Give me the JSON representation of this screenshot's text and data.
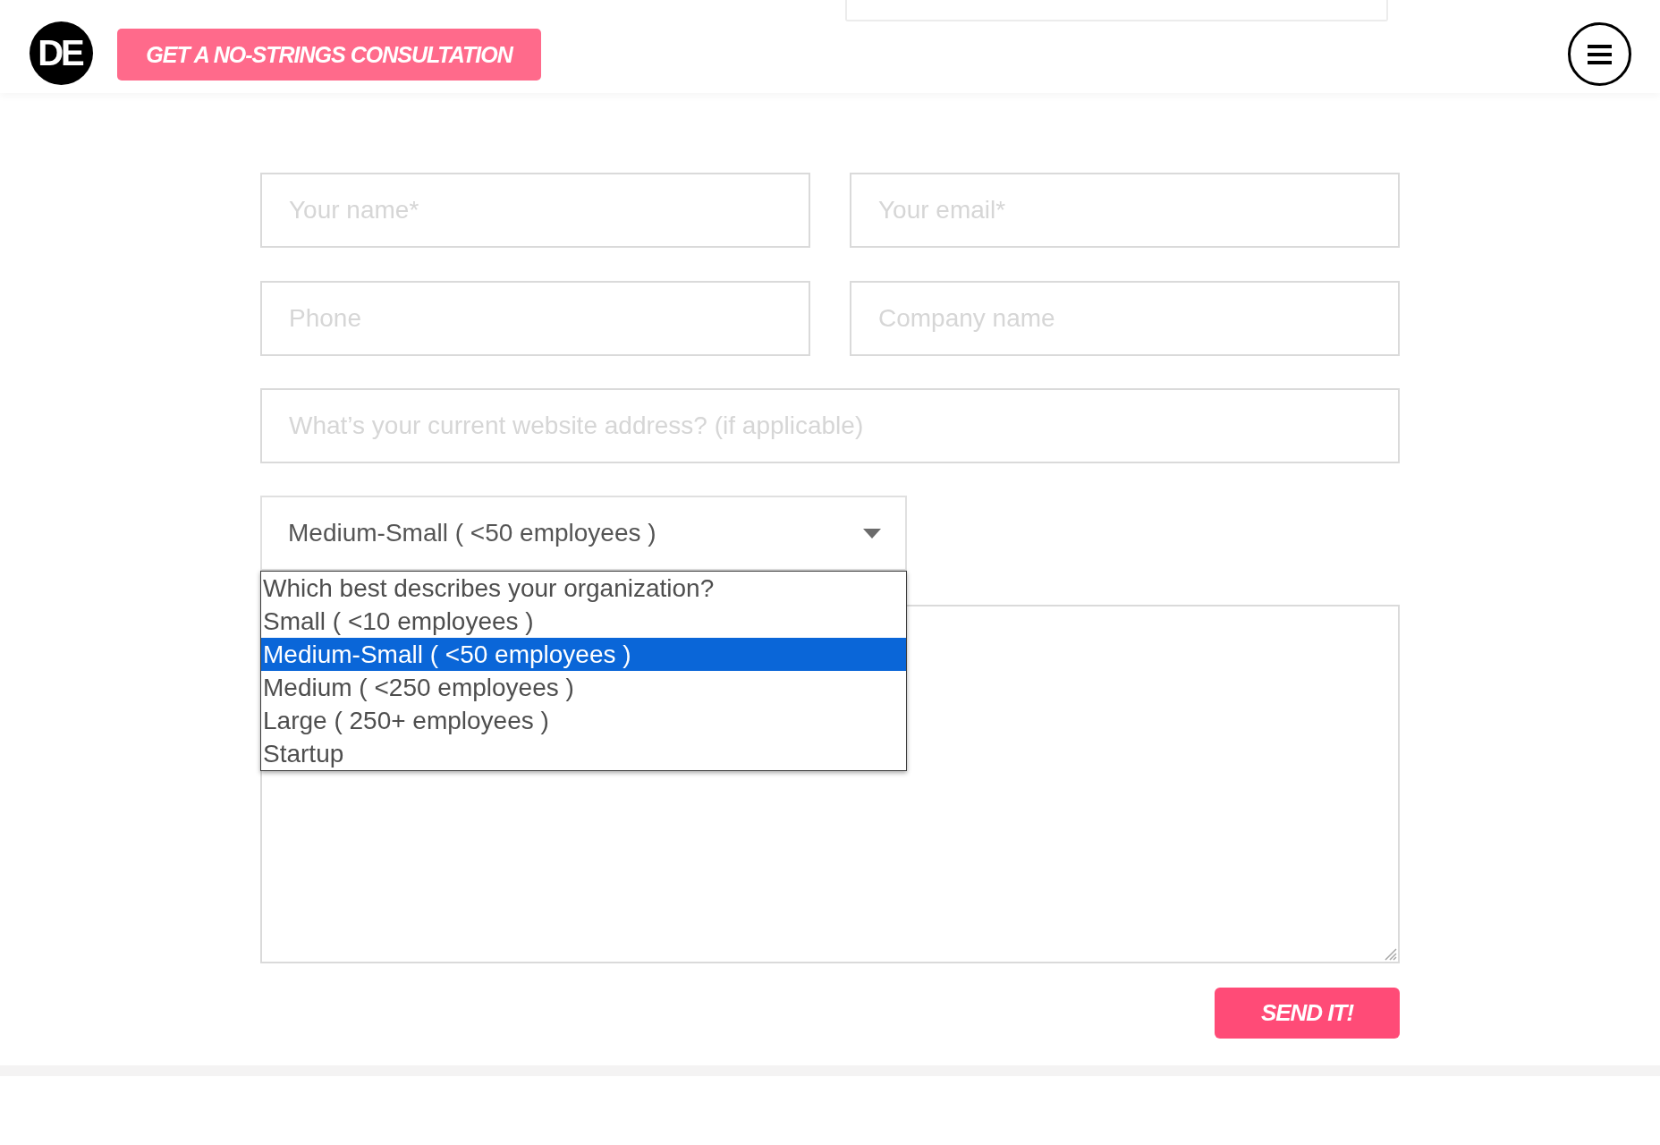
{
  "header": {
    "logo": "DE",
    "cta_button": "GET A NO-STRINGS CONSULTATION"
  },
  "form": {
    "fields": [
      {
        "placeholder": "Your name*"
      },
      {
        "placeholder": "Your email*"
      },
      {
        "placeholder": "Phone"
      },
      {
        "placeholder": "Company name"
      }
    ],
    "website_field": {
      "placeholder": "What’s your current website address? (if applicable)"
    },
    "select": {
      "value": "Medium-Small ( <50 employees )",
      "expanded": true,
      "options": [
        {
          "label": "Which best describes your organization?",
          "selected": false
        },
        {
          "label": "Small ( <10 employees )",
          "selected": false
        },
        {
          "label": "Medium-Small ( <50 employees )",
          "selected": true
        },
        {
          "label": "Medium ( <250 employees )",
          "selected": false
        },
        {
          "label": "Large ( 250+ employees )",
          "selected": false
        },
        {
          "label": "Startup",
          "selected": false
        }
      ]
    },
    "submit_button": "SEND IT!"
  }
}
